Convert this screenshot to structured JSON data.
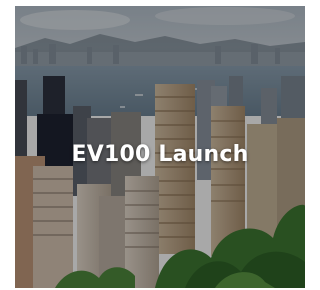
{
  "card": {
    "title": "EV100 Launch",
    "image_description_icon": "city-skyline-photo",
    "overlay_color": "#000000"
  }
}
